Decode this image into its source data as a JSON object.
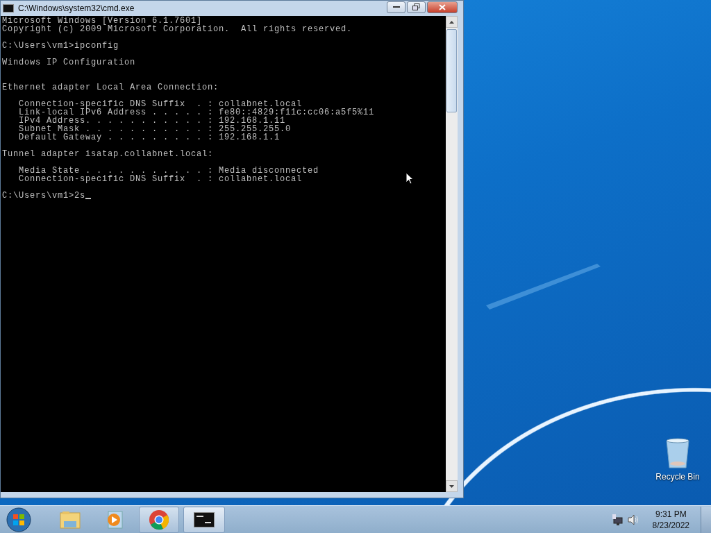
{
  "window": {
    "title": "C:\\Windows\\system32\\cmd.exe",
    "console_output": "Microsoft Windows [Version 6.1.7601]\nCopyright (c) 2009 Microsoft Corporation.  All rights reserved.\n\nC:\\Users\\vm1>ipconfig\n\nWindows IP Configuration\n\n\nEthernet adapter Local Area Connection:\n\n   Connection-specific DNS Suffix  . : collabnet.local\n   Link-local IPv6 Address . . . . . : fe80::4829:f11c:cc06:a5f5%11\n   IPv4 Address. . . . . . . . . . . : 192.168.1.11\n   Subnet Mask . . . . . . . . . . . : 255.255.255.0\n   Default Gateway . . . . . . . . . : 192.168.1.1\n\nTunnel adapter isatap.collabnet.local:\n\n   Media State . . . . . . . . . . . : Media disconnected\n   Connection-specific DNS Suffix  . : collabnet.local",
    "prompt": "C:\\Users\\vm1>2s"
  },
  "desktop_icons": [
    {
      "label": "Recycle Bin"
    }
  ],
  "taskbar": {
    "items": [
      {
        "kind": "explorer",
        "selected": false
      },
      {
        "kind": "media",
        "selected": false
      },
      {
        "kind": "chrome",
        "selected": false
      },
      {
        "kind": "cmd",
        "selected": true
      }
    ],
    "clock": {
      "time": "9:31 PM",
      "date": "8/23/2022"
    }
  }
}
